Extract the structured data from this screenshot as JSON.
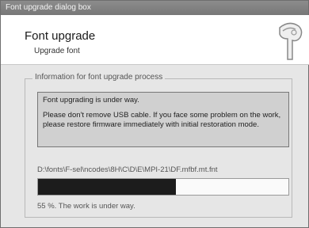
{
  "window": {
    "title": "Font upgrade dialog box"
  },
  "header": {
    "title": "Font upgrade",
    "subtitle": "Upgrade font"
  },
  "group": {
    "label": "Information for font upgrade process",
    "message_line1": "Font upgrading is under way.",
    "message_line2": "Please don't remove USB cable. If you face some problem on the work, please restore firmware immediately with initial restoration mode."
  },
  "file_path": "D:\\fonts\\F-sel\\ncodes\\8H\\C\\D\\E\\MPI-21\\DF.mfbf.mt.fnt",
  "progress": {
    "percent": 55,
    "status_text": "55 %. The work is under way."
  }
}
